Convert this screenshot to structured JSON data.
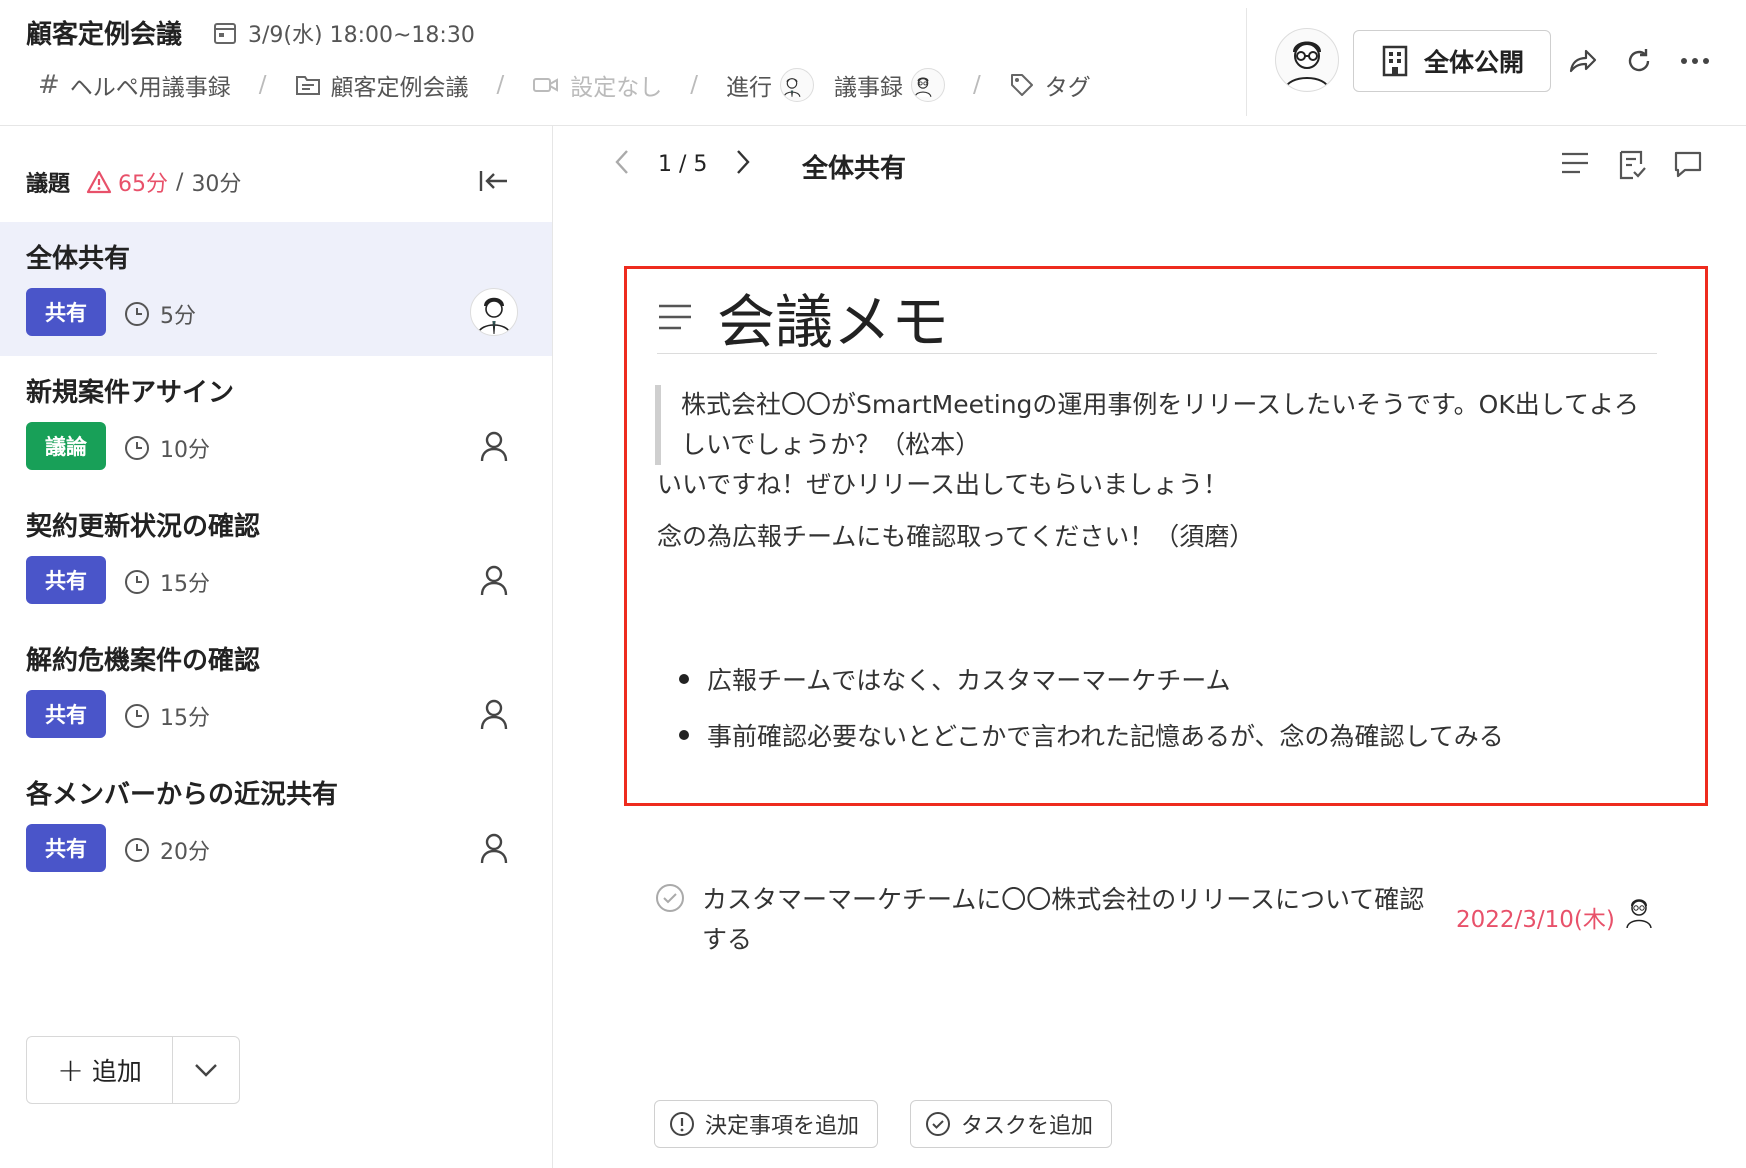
{
  "header": {
    "title": "顧客定例会議",
    "date": "3/9(水) 18:00~18:30",
    "meta": {
      "channel": "ヘルペ用議事録",
      "folder": "顧客定例会議",
      "video": "設定なし",
      "facilitator_label": "進行",
      "minutes_label": "議事録",
      "tag_label": "タグ"
    },
    "publish_label": "全体公開"
  },
  "sidebar": {
    "heading": "議題",
    "total_time": "65分",
    "slash": "/",
    "planned_time": "30分",
    "items": [
      {
        "title": "全体共有",
        "badge": "共有",
        "duration": "5分"
      },
      {
        "title": "新規案件アサイン",
        "badge": "議論",
        "duration": "10分"
      },
      {
        "title": "契約更新状況の確認",
        "badge": "共有",
        "duration": "15分"
      },
      {
        "title": "解約危機案件の確認",
        "badge": "共有",
        "duration": "15分"
      },
      {
        "title": "各メンバーからの近況共有",
        "badge": "共有",
        "duration": "20分"
      }
    ],
    "add_label": "追加"
  },
  "main": {
    "pager": "1 / 5",
    "title": "全体共有",
    "memo": {
      "heading": "会議メモ",
      "quote": "株式会社〇〇がSmartMeetingの運用事例をリリースしたいそうです。OK出してよろしいでしょうか？（松本）",
      "para1": "いいですね！ぜひリリース出してもらいましょう！",
      "para2": "念の為広報チームにも確認取ってください！（須磨）",
      "bullets": [
        "広報チームではなく、カスタマーマーケチーム",
        "事前確認必要ないとどこかで言われた記憶あるが、念の為確認してみる"
      ]
    },
    "task": {
      "text": "カスタマーマーケチームに〇〇株式会社のリリースについて確認する",
      "due": "2022/3/10(木)"
    },
    "buttons": {
      "add_decision": "決定事項を追加",
      "add_task": "タスクを追加"
    }
  },
  "colors": {
    "accent_share": "#4a55c9",
    "accent_discuss": "#18a058",
    "warning": "#e8516a",
    "highlight_border": "#ee2b1e",
    "active_row": "#eef0fa"
  }
}
